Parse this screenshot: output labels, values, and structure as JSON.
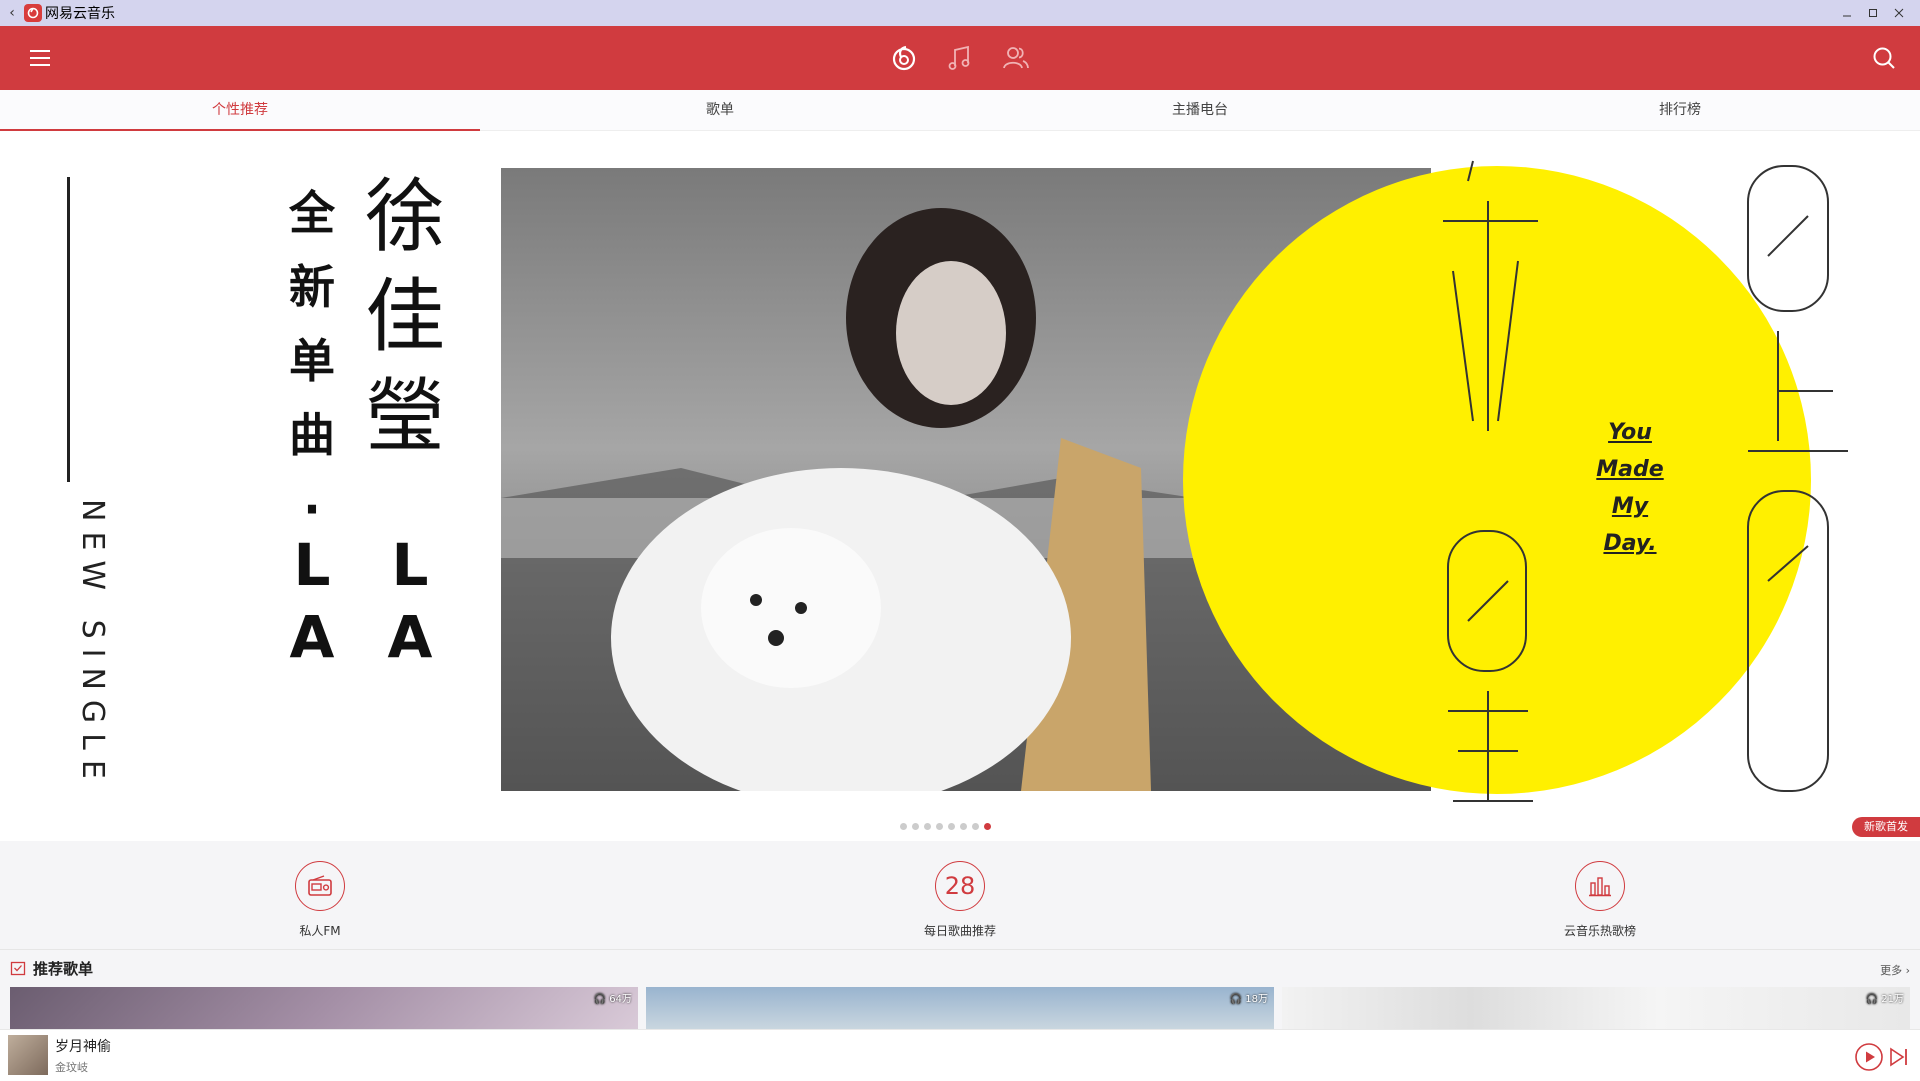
{
  "window": {
    "title": "网易云音乐",
    "back_icon": "back-arrow-icon",
    "controls": [
      "minimize-icon",
      "maximize-icon",
      "close-icon"
    ]
  },
  "header": {
    "menu_icon": "hamburger-menu-icon",
    "nav_icons": [
      "netease-music-logo-icon",
      "music-note-icon",
      "friends-icon"
    ],
    "search_icon": "search-icon",
    "brand_color": "#d03b3f"
  },
  "tabs": [
    {
      "label": "个性推荐",
      "active": true
    },
    {
      "label": "歌单",
      "active": false
    },
    {
      "label": "主播电台",
      "active": false
    },
    {
      "label": "排行榜",
      "active": false
    }
  ],
  "banner": {
    "vertical_text": "NEW SINGLE",
    "small_column": [
      "全",
      "新",
      "单",
      "曲",
      "·",
      "L",
      "A"
    ],
    "big_column": [
      "徐",
      "佳",
      "瑩",
      "L",
      "A"
    ],
    "english_lines": [
      "You",
      "Made",
      "My",
      "Day."
    ],
    "accent_color": "#fff000",
    "badge": "新歌首发",
    "dot_count": 8,
    "active_dot": 8
  },
  "quick_entries": [
    {
      "label": "私人FM",
      "icon": "radio-icon"
    },
    {
      "label": "每日歌曲推荐",
      "icon": "calendar-day-icon",
      "value": "28"
    },
    {
      "label": "云音乐热歌榜",
      "icon": "chart-bars-icon"
    }
  ],
  "recommended": {
    "title": "推荐歌单",
    "icon": "playlist-icon",
    "more": "更多",
    "playlists": [
      {
        "plays": "64万"
      },
      {
        "plays": "18万"
      },
      {
        "plays": "21万"
      }
    ]
  },
  "player": {
    "song": "岁月神偷",
    "artist": "金玟岐",
    "play_icon": "play-circle-icon",
    "next_icon": "skip-next-icon"
  }
}
